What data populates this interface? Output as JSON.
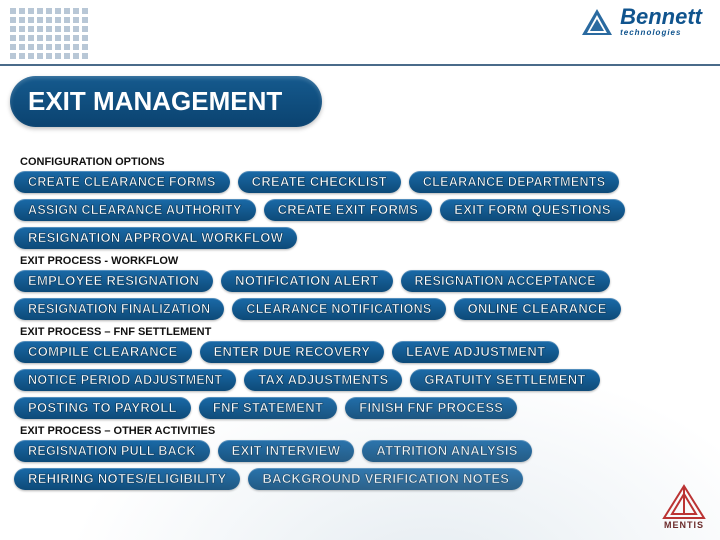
{
  "brand": {
    "name": "Bennett",
    "sub": "technologies"
  },
  "title": "EXIT MANAGEMENT",
  "footer_logo": "MENTIS",
  "sections": [
    {
      "label": "CONFIGURATION OPTIONS",
      "rows": [
        [
          "CREATE CLEARANCE FORMS",
          "CREATE CHECKLIST",
          "CLEARANCE DEPARTMENTS"
        ],
        [
          "ASSIGN CLEARANCE AUTHORITY",
          "CREATE EXIT FORMS",
          "EXIT FORM QUESTIONS"
        ],
        [
          "RESIGNATION APPROVAL WORKFLOW"
        ]
      ]
    },
    {
      "label": "EXIT PROCESS - WORKFLOW",
      "rows": [
        [
          "EMPLOYEE RESIGNATION",
          "NOTIFICATION ALERT",
          "RESIGNATION ACCEPTANCE"
        ],
        [
          "RESIGNATION  FINALIZATION",
          "CLEARANCE NOTIFICATIONS",
          "ONLINE CLEARANCE"
        ]
      ]
    },
    {
      "label": "EXIT PROCESS – FNF SETTLEMENT",
      "rows": [
        [
          "COMPILE CLEARANCE",
          "ENTER DUE RECOVERY",
          "LEAVE ADJUSTMENT"
        ],
        [
          "NOTICE PERIOD ADJUSTMENT",
          "TAX ADJUSTMENTS",
          "GRATUITY SETTLEMENT"
        ],
        [
          "POSTING TO PAYROLL",
          "FNF STATEMENT",
          "FINISH FNF PROCESS"
        ]
      ]
    },
    {
      "label": "EXIT PROCESS – OTHER ACTIVITIES",
      "rows": [
        [
          "REGISNATION PULL BACK",
          "EXIT INTERVIEW",
          "ATTRITION ANALYSIS"
        ],
        [
          "REHIRING NOTES/ELIGIBILITY",
          "BACKGROUND VERIFICATION NOTES"
        ]
      ]
    }
  ]
}
